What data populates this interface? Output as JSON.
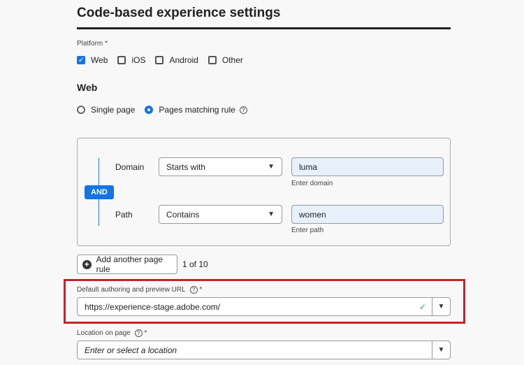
{
  "title": "Code-based experience settings",
  "platform": {
    "label": "Platform",
    "required": "*",
    "options": [
      {
        "label": "Web",
        "checked": true
      },
      {
        "label": "iOS",
        "checked": false
      },
      {
        "label": "Android",
        "checked": false
      },
      {
        "label": "Other",
        "checked": false
      }
    ]
  },
  "web": {
    "heading": "Web",
    "single_page": "Single page",
    "pages_matching": "Pages matching rule"
  },
  "rule": {
    "operator": "AND",
    "domain_label": "Domain",
    "domain_op": "Starts with",
    "domain_value": "luma",
    "domain_hint": "Enter domain",
    "path_label": "Path",
    "path_op": "Contains",
    "path_value": "women",
    "path_hint": "Enter path"
  },
  "add_rule": {
    "label": "Add another page rule",
    "count": "1 of 10"
  },
  "url": {
    "label": "Default authoring and preview URL",
    "required": "*",
    "value": "https://experience-stage.adobe.com/"
  },
  "location": {
    "label": "Location on page",
    "required": "*",
    "placeholder": "Enter or select a location"
  },
  "colors": {
    "accent": "#1473e6",
    "highlight": "#c0262b"
  }
}
